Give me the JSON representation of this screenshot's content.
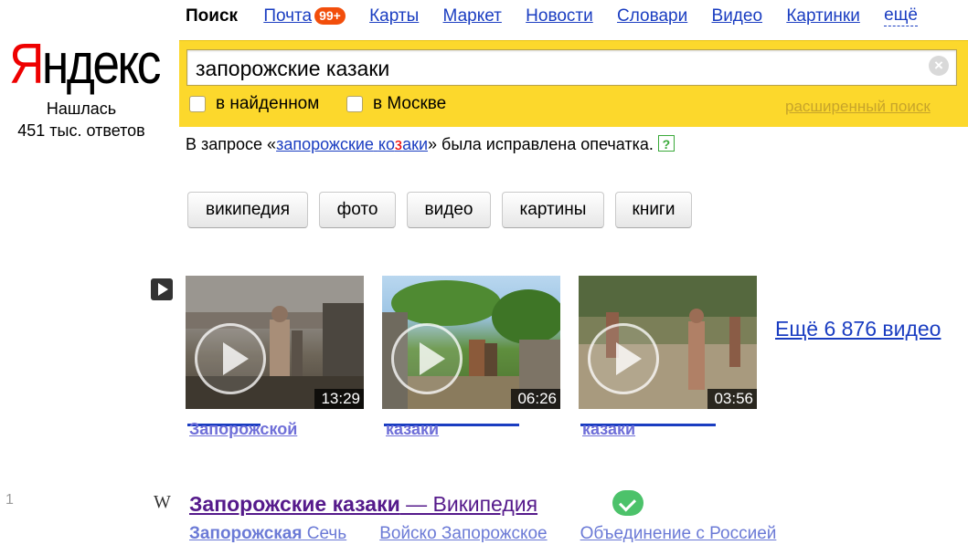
{
  "logo": {
    "first_letter": "Я",
    "rest": "ндекс"
  },
  "found": {
    "line1": "Нашлась",
    "line2": "451 тыс. ответов"
  },
  "nav": {
    "current": "Поиск",
    "mail": "Почта",
    "mail_badge": "99+",
    "maps": "Карты",
    "market": "Маркет",
    "news": "Новости",
    "dictionaries": "Словари",
    "video": "Видео",
    "images": "Картинки",
    "more": "ещё"
  },
  "search": {
    "value": "запорожские казаки",
    "clear_symbol": "×",
    "filter_found": "в найденном",
    "filter_moscow": "в Москве",
    "advanced": "расширенный поиск"
  },
  "typo": {
    "prefix": "В запросе «",
    "word1": "запорожские",
    "word2_a": "ко",
    "word2_b": "з",
    "word2_c": "аки",
    "suffix": "» была исправлена опечатка.",
    "help_symbol": "?"
  },
  "suggestions": [
    "википедия",
    "фото",
    "видео",
    "картины",
    "книги"
  ],
  "videos": {
    "items": [
      {
        "duration": "13:29",
        "title": "Запорожской"
      },
      {
        "duration": "06:26",
        "title": "казаки"
      },
      {
        "duration": "03:56",
        "title": "казаки"
      }
    ],
    "more": "Ещё 6 876 видео"
  },
  "result": {
    "number": "1",
    "site_icon": "W",
    "title_bold": "Запорожские казаки",
    "title_rest": " — Википедия",
    "sublinks": [
      {
        "bold": "Запорожская",
        "rest": " Сечь"
      },
      {
        "bold": "",
        "rest": "Войско Запорожское"
      },
      {
        "bold": "",
        "rest": "Объединение с Россией"
      }
    ]
  }
}
